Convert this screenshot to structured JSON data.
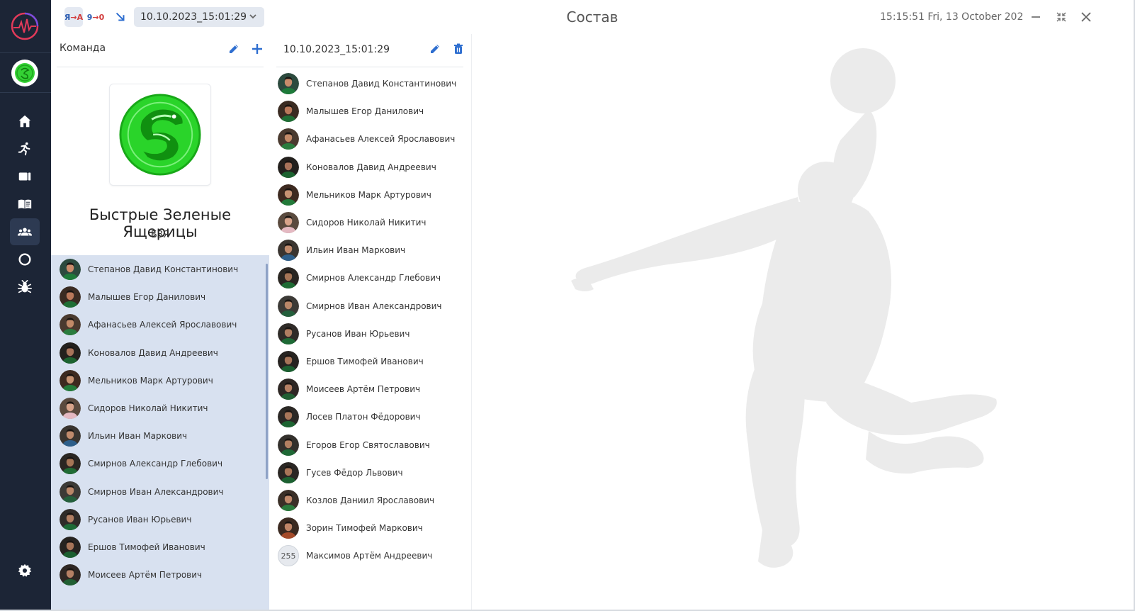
{
  "header": {
    "chip_ya": {
      "a": "Я",
      "arrow": "→",
      "b": "А"
    },
    "chip_90": {
      "a": "9",
      "arrow": "→",
      "b": "0"
    },
    "selected_date": "10.10.2023_15:01:29",
    "title": "Состав",
    "clock": "15:15:51  Fri, 13 October 202"
  },
  "team_panel": {
    "label": "Команда",
    "team_name": "Быстрые Зеленые Ящерицы",
    "team_abbr": "БЗЯ",
    "players": [
      "Степанов Давид Константинович",
      "Малышев Егор Данилович",
      "Афанасьев Алексей Ярославович",
      "Коновалов Давид Андреевич",
      "Мельников Марк Артурович",
      "Сидоров Николай Никитич",
      "Ильин Иван Маркович",
      "Смирнов Александр Глебович",
      "Смирнов Иван Александрович",
      "Русанов Иван Юрьевич",
      "Ершов Тимофей  Иванович",
      "Моисеев Артём Петрович"
    ]
  },
  "roster_panel": {
    "label": "10.10.2023_15:01:29",
    "players": [
      "Степанов Давид Константинович",
      "Малышев Егор Данилович",
      "Афанасьев Алексей Ярославович",
      "Коновалов Давид Андреевич",
      "Мельников Марк Артурович",
      "Сидоров Николай Никитич",
      "Ильин Иван Маркович",
      "Смирнов Александр Глебович",
      "Смирнов Иван Александрович",
      "Русанов Иван Юрьевич",
      "Ершов Тимофей  Иванович",
      "Моисеев Артём Петрович",
      "Лосев Платон  Фёдорович",
      "Егоров Егор Святославович",
      "Гусев Фёдор Львович",
      "Козлов Даниил Ярославович",
      "Зорин Тимофей Маркович",
      "Максимов Артём Андреевич"
    ],
    "last_player_number": "255"
  },
  "colors": {
    "sidebar": "#1c2536",
    "accent": "#2f6fd0",
    "list_highlight": "#d8e1f0",
    "team_green": "#33d633"
  },
  "icons": {
    "sidebar": [
      "app-logo-icon",
      "team-logo-icon",
      "home-icon",
      "running-icon",
      "video-icon",
      "book-icon",
      "team-icon",
      "circle-icon",
      "bug-icon",
      "settings-icon"
    ],
    "header": [
      "chevron-down-icon",
      "minimize-icon",
      "collapse-icon",
      "close-icon"
    ],
    "panels": [
      "edit-icon",
      "add-icon",
      "delete-icon"
    ]
  }
}
